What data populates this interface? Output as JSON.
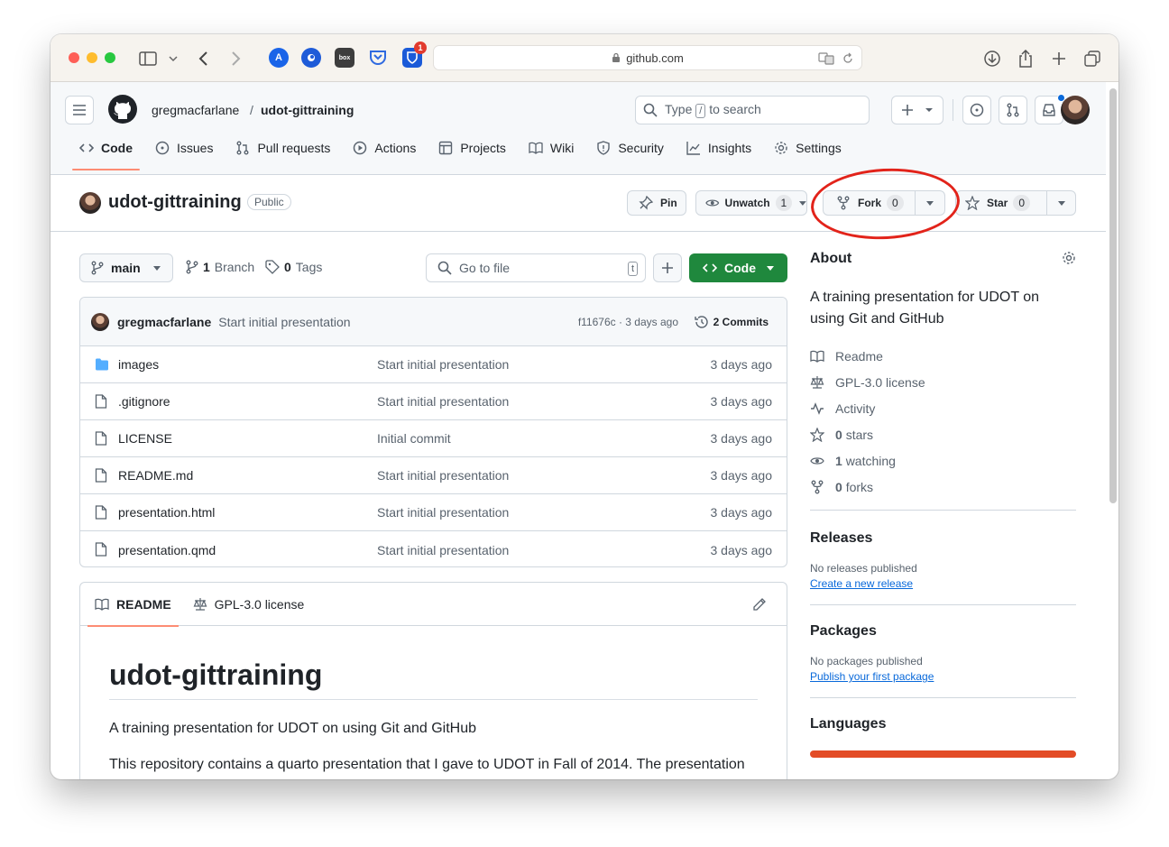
{
  "browser": {
    "url": "github.com",
    "extension_badge": "1"
  },
  "header": {
    "owner": "gregmacfarlane",
    "separator": "/",
    "repo": "udot-gittraining",
    "search_prefix": "Type",
    "search_key": "/",
    "search_suffix": "to search"
  },
  "tabs": [
    {
      "label": "Code"
    },
    {
      "label": "Issues"
    },
    {
      "label": "Pull requests"
    },
    {
      "label": "Actions"
    },
    {
      "label": "Projects"
    },
    {
      "label": "Wiki"
    },
    {
      "label": "Security"
    },
    {
      "label": "Insights"
    },
    {
      "label": "Settings"
    }
  ],
  "repo_title": {
    "name": "udot-gittraining",
    "visibility": "Public",
    "pin_label": "Pin",
    "watch_label": "Unwatch",
    "watch_count": "1",
    "fork_label": "Fork",
    "fork_count": "0",
    "star_label": "Star",
    "star_count": "0"
  },
  "toolbar": {
    "branch": "main",
    "branch_count": "1",
    "branch_word": "Branch",
    "tag_count": "0",
    "tag_word": "Tags",
    "goto_placeholder": "Go to file",
    "goto_key": "t",
    "code_label": "Code"
  },
  "commit": {
    "author": "gregmacfarlane",
    "message": "Start initial presentation",
    "hash_time": "f11676c · 3 days ago",
    "count": "2 Commits"
  },
  "files": [
    {
      "name": "images",
      "message": "Start initial presentation",
      "date": "3 days ago",
      "type": "folder"
    },
    {
      "name": ".gitignore",
      "message": "Start initial presentation",
      "date": "3 days ago",
      "type": "file"
    },
    {
      "name": "LICENSE",
      "message": "Initial commit",
      "date": "3 days ago",
      "type": "file"
    },
    {
      "name": "README.md",
      "message": "Start initial presentation",
      "date": "3 days ago",
      "type": "file"
    },
    {
      "name": "presentation.html",
      "message": "Start initial presentation",
      "date": "3 days ago",
      "type": "file"
    },
    {
      "name": "presentation.qmd",
      "message": "Start initial presentation",
      "date": "3 days ago",
      "type": "file"
    }
  ],
  "readme": {
    "tab_readme": "README",
    "tab_license": "GPL-3.0 license",
    "heading": "udot-gittraining",
    "para1": "A training presentation for UDOT on using Git and GitHub",
    "para2": "This repository contains a quarto presentation that I gave to UDOT in Fall of 2014. The presentation"
  },
  "about": {
    "title": "About",
    "description": "A training presentation for UDOT on using Git and GitHub",
    "items": [
      {
        "bold": "",
        "label": "Readme"
      },
      {
        "bold": "",
        "label": "GPL-3.0 license"
      },
      {
        "bold": "",
        "label": "Activity"
      },
      {
        "bold": "0",
        "label": "stars"
      },
      {
        "bold": "1",
        "label": "watching"
      },
      {
        "bold": "0",
        "label": "forks"
      }
    ]
  },
  "releases": {
    "title": "Releases",
    "empty": "No releases published",
    "link": "Create a new release"
  },
  "packages": {
    "title": "Packages",
    "empty": "No packages published",
    "link": "Publish your first package"
  },
  "languages": {
    "title": "Languages",
    "bar_color": "#e34c26"
  },
  "colors": {
    "accent_green": "#1f883d",
    "link_blue": "#0969da",
    "annotation_red": "#e2231a"
  }
}
